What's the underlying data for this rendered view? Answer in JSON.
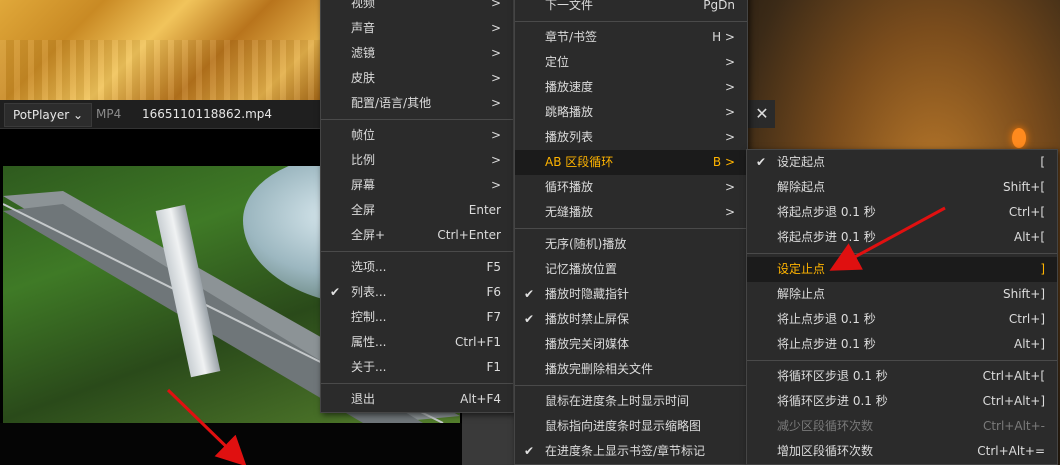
{
  "player": {
    "app_menu": "PotPlayer ⌄",
    "format": "MP4",
    "filename": "1665110118862.mp4",
    "close": "✕"
  },
  "menu1": [
    {
      "label": "视频",
      "arrow": ">"
    },
    {
      "label": "声音",
      "arrow": ">"
    },
    {
      "label": "滤镜",
      "arrow": ">"
    },
    {
      "label": "皮肤",
      "arrow": ">"
    },
    {
      "label": "配置/语言/其他",
      "arrow": ">"
    },
    {
      "sep": true
    },
    {
      "label": "帧位",
      "arrow": ">"
    },
    {
      "label": "比例",
      "arrow": ">"
    },
    {
      "label": "屏幕",
      "arrow": ">"
    },
    {
      "label": "全屏",
      "shortcut": "Enter"
    },
    {
      "label": "全屏+",
      "shortcut": "Ctrl+Enter"
    },
    {
      "sep": true
    },
    {
      "label": "选项...",
      "shortcut": "F5"
    },
    {
      "label": "列表...",
      "shortcut": "F6",
      "checked": true
    },
    {
      "label": "控制...",
      "shortcut": "F7"
    },
    {
      "label": "属性...",
      "shortcut": "Ctrl+F1"
    },
    {
      "label": "关于...",
      "shortcut": "F1"
    },
    {
      "sep": true
    },
    {
      "label": "退出",
      "shortcut": "Alt+F4"
    }
  ],
  "menu2": [
    {
      "label": "下一文件",
      "shortcut": "PgDn"
    },
    {
      "sep": true
    },
    {
      "label": "章节/书签",
      "shortcut": "H >"
    },
    {
      "label": "定位",
      "arrow": ">"
    },
    {
      "label": "播放速度",
      "arrow": ">"
    },
    {
      "label": "跳略播放",
      "arrow": ">"
    },
    {
      "label": "播放列表",
      "arrow": ">"
    },
    {
      "label": "AB 区段循环",
      "shortcut": "B >",
      "highlighted": true
    },
    {
      "label": "循环播放",
      "arrow": ">"
    },
    {
      "label": "无缝播放",
      "arrow": ">"
    },
    {
      "sep": true
    },
    {
      "label": "无序(随机)播放"
    },
    {
      "label": "记忆播放位置"
    },
    {
      "label": "播放时隐藏指针",
      "checked": true
    },
    {
      "label": "播放时禁止屏保",
      "checked": true
    },
    {
      "label": "播放完关闭媒体"
    },
    {
      "label": "播放完删除相关文件"
    },
    {
      "sep": true
    },
    {
      "label": "鼠标在进度条上时显示时间"
    },
    {
      "label": "鼠标指向进度条时显示缩略图"
    },
    {
      "label": "在进度条上显示书签/章节标记",
      "checked": true
    }
  ],
  "menu3": [
    {
      "label": "设定起点",
      "shortcut": "[",
      "checked": true
    },
    {
      "label": "解除起点",
      "shortcut": "Shift+["
    },
    {
      "label": "将起点步退 0.1 秒",
      "shortcut": "Ctrl+["
    },
    {
      "label": "将起点步进 0.1 秒",
      "shortcut": "Alt+["
    },
    {
      "sep": true
    },
    {
      "label": "设定止点",
      "shortcut": "]",
      "highlighted": true
    },
    {
      "label": "解除止点",
      "shortcut": "Shift+]"
    },
    {
      "label": "将止点步退 0.1 秒",
      "shortcut": "Ctrl+]"
    },
    {
      "label": "将止点步进 0.1 秒",
      "shortcut": "Alt+]"
    },
    {
      "sep": true
    },
    {
      "label": "将循环区步退 0.1 秒",
      "shortcut": "Ctrl+Alt+["
    },
    {
      "label": "将循环区步进 0.1 秒",
      "shortcut": "Ctrl+Alt+]"
    },
    {
      "label": "减少区段循环次数",
      "shortcut": "Ctrl+Alt+-",
      "disabled": true
    },
    {
      "label": "增加区段循环次数",
      "shortcut": "Ctrl+Alt+="
    }
  ],
  "colors": {
    "highlight": "#ffb400",
    "annotation_arrow": "#e01010"
  }
}
